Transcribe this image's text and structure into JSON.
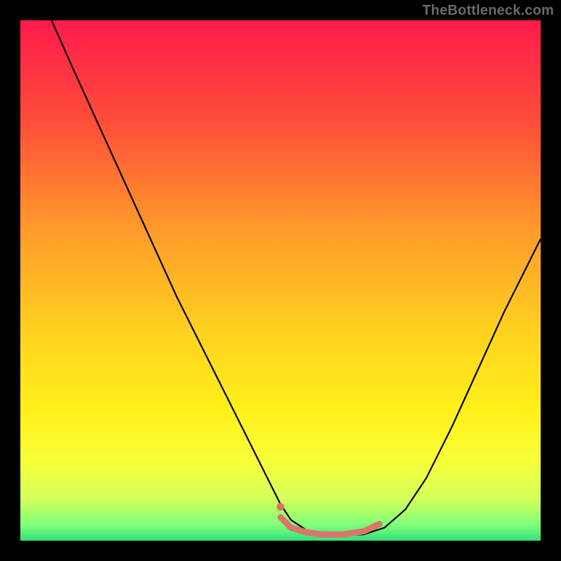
{
  "attribution": "TheBottleneck.com",
  "chart_data": {
    "type": "line",
    "title": "",
    "xlabel": "",
    "ylabel": "",
    "xlim": [
      0,
      100
    ],
    "ylim": [
      0,
      100
    ],
    "background_gradient": {
      "orientation": "vertical",
      "stops": [
        {
          "offset": 0.0,
          "color": "#ff1a4b"
        },
        {
          "offset": 0.2,
          "color": "#ff4f3a"
        },
        {
          "offset": 0.4,
          "color": "#ff9a2a"
        },
        {
          "offset": 0.6,
          "color": "#ffd21f"
        },
        {
          "offset": 0.75,
          "color": "#fff01a"
        },
        {
          "offset": 0.85,
          "color": "#f7ff3a"
        },
        {
          "offset": 0.92,
          "color": "#d4ff5a"
        },
        {
          "offset": 0.97,
          "color": "#7fff7a"
        },
        {
          "offset": 1.0,
          "color": "#31e07a"
        }
      ]
    },
    "series": [
      {
        "name": "curve",
        "stroke": "#000000",
        "stroke_width": 2.2,
        "x": [
          6,
          10,
          15,
          20,
          25,
          30,
          35,
          40,
          45,
          48,
          50,
          52,
          55,
          58,
          62,
          66,
          70,
          74,
          78,
          83,
          88,
          93,
          98,
          100
        ],
        "y": [
          100,
          91,
          80,
          69,
          58,
          47,
          37,
          27,
          17,
          11,
          7,
          4,
          2,
          1.2,
          1.0,
          1.2,
          2.5,
          6,
          12,
          22,
          33,
          44,
          54,
          58
        ]
      },
      {
        "name": "highlight-band",
        "stroke": "#d9766a",
        "stroke_width": 9,
        "linecap": "round",
        "x": [
          50,
          52,
          55,
          58,
          62,
          66,
          69
        ],
        "y": [
          4.5,
          2.5,
          1.6,
          1.2,
          1.2,
          1.8,
          3.2
        ]
      }
    ],
    "markers": [
      {
        "name": "highlight-start-dot",
        "x": 50,
        "y": 6.5,
        "r": 5.5,
        "fill": "#d9766a"
      }
    ]
  }
}
